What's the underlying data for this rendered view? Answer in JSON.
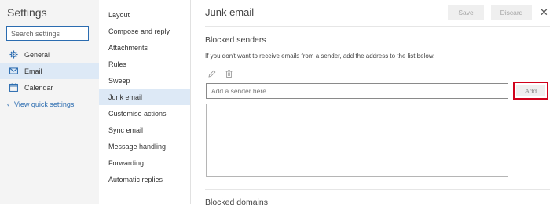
{
  "settings": {
    "title": "Settings",
    "search_placeholder": "Search settings",
    "nav": [
      {
        "label": "General",
        "icon": "gear-icon"
      },
      {
        "label": "Email",
        "icon": "envelope-icon"
      },
      {
        "label": "Calendar",
        "icon": "calendar-icon"
      }
    ],
    "quick_settings_label": "View quick settings"
  },
  "categories": [
    "Layout",
    "Compose and reply",
    "Attachments",
    "Rules",
    "Sweep",
    "Junk email",
    "Customise actions",
    "Sync email",
    "Message handling",
    "Forwarding",
    "Automatic replies"
  ],
  "main": {
    "title": "Junk email",
    "save_label": "Save",
    "discard_label": "Discard",
    "close_glyph": "✕",
    "blocked_senders_title": "Blocked senders",
    "blocked_senders_desc": "If you don't want to receive emails from a sender, add the address to the list below.",
    "sender_placeholder": "Add a sender here",
    "add_label": "Add",
    "blocked_domains_title": "Blocked domains"
  },
  "colors": {
    "accent": "#2b6cb0",
    "highlight": "#d0021b",
    "selected_bg": "#dde9f6"
  }
}
